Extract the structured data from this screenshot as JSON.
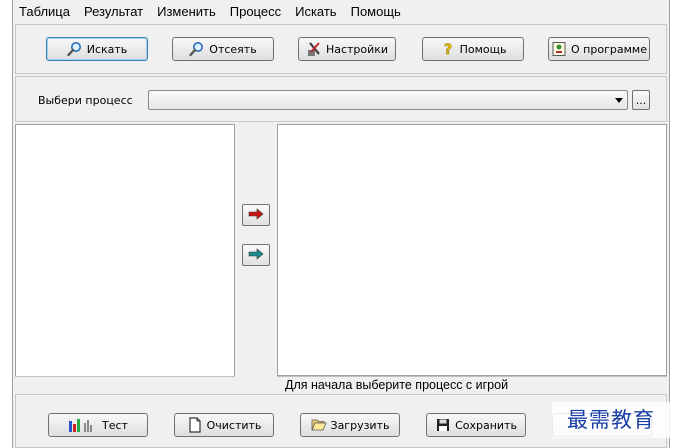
{
  "menu": [
    "Таблица",
    "Результат",
    "Изменить",
    "Процесс",
    "Искать",
    "Помощь"
  ],
  "toolbar": {
    "search": "Искать",
    "filter": "Отсеять",
    "settings": "Настройки",
    "help": "Помощь",
    "about": "О программе"
  },
  "process": {
    "label": "Выбери процесс",
    "selected": "",
    "browse": "..."
  },
  "status": {
    "right": "Для начала выберите процесс с игрой"
  },
  "bottom": {
    "test": "Тест",
    "clear": "Очистить",
    "load": "Загрузить",
    "save": "Сохранить"
  },
  "watermark": "最需教育",
  "colors": {
    "arrow_right": "#cc1111",
    "arrow_left": "#1b8a8a",
    "watermark": "#1a3fa6"
  }
}
